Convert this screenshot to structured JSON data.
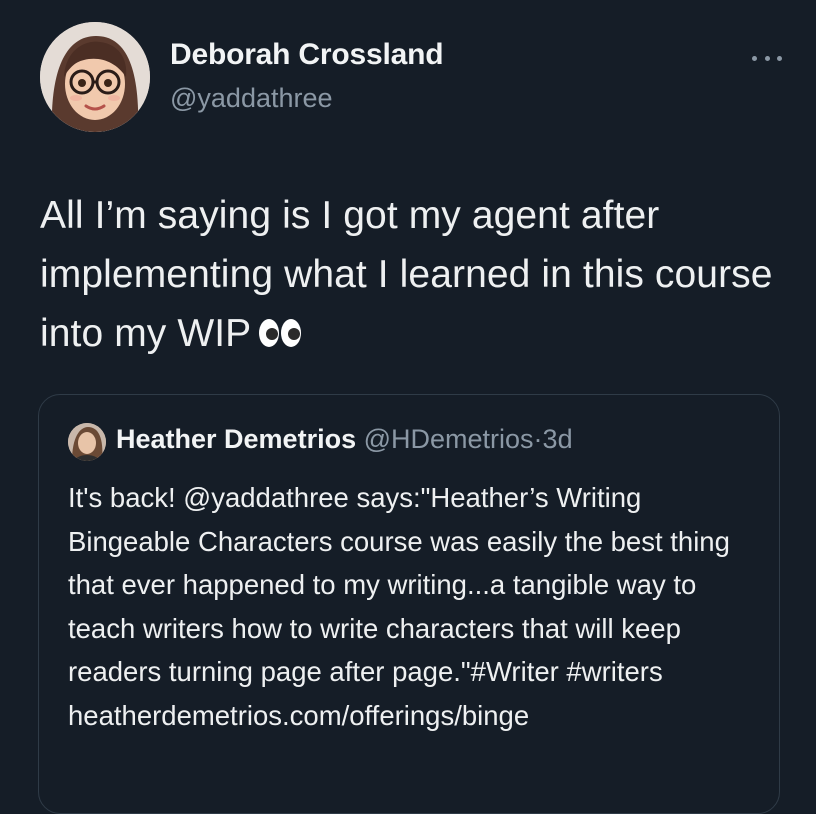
{
  "tweet": {
    "author": {
      "name": "Deborah Crossland",
      "handle": "@yaddathree",
      "avatar_icon": "cartoon-avatar-woman-glasses"
    },
    "more_icon": "ellipsis-icon",
    "text": "All I’m saying is I got my agent after implementing what I learned in this course into my WIP",
    "emoji": "eyes-emoji"
  },
  "quoted_tweet": {
    "author": {
      "name": "Heather Demetrios",
      "handle": "@HDemetrios",
      "avatar_icon": "photo-avatar"
    },
    "separator": "·",
    "time": "3d",
    "text": "It's back! @yaddathree says:\"Heather’s Writing Bingeable Characters course was easily the best thing that ever happened to my writing...a tangible way to teach writers how to write characters that will keep readers turning page after page.\"#Writer #writers heatherdemetrios.com/offerings/binge"
  },
  "colors": {
    "background": "#151d27",
    "text": "#eef0f1",
    "secondary_text": "#8b98a5",
    "border": "#2f3b47"
  }
}
